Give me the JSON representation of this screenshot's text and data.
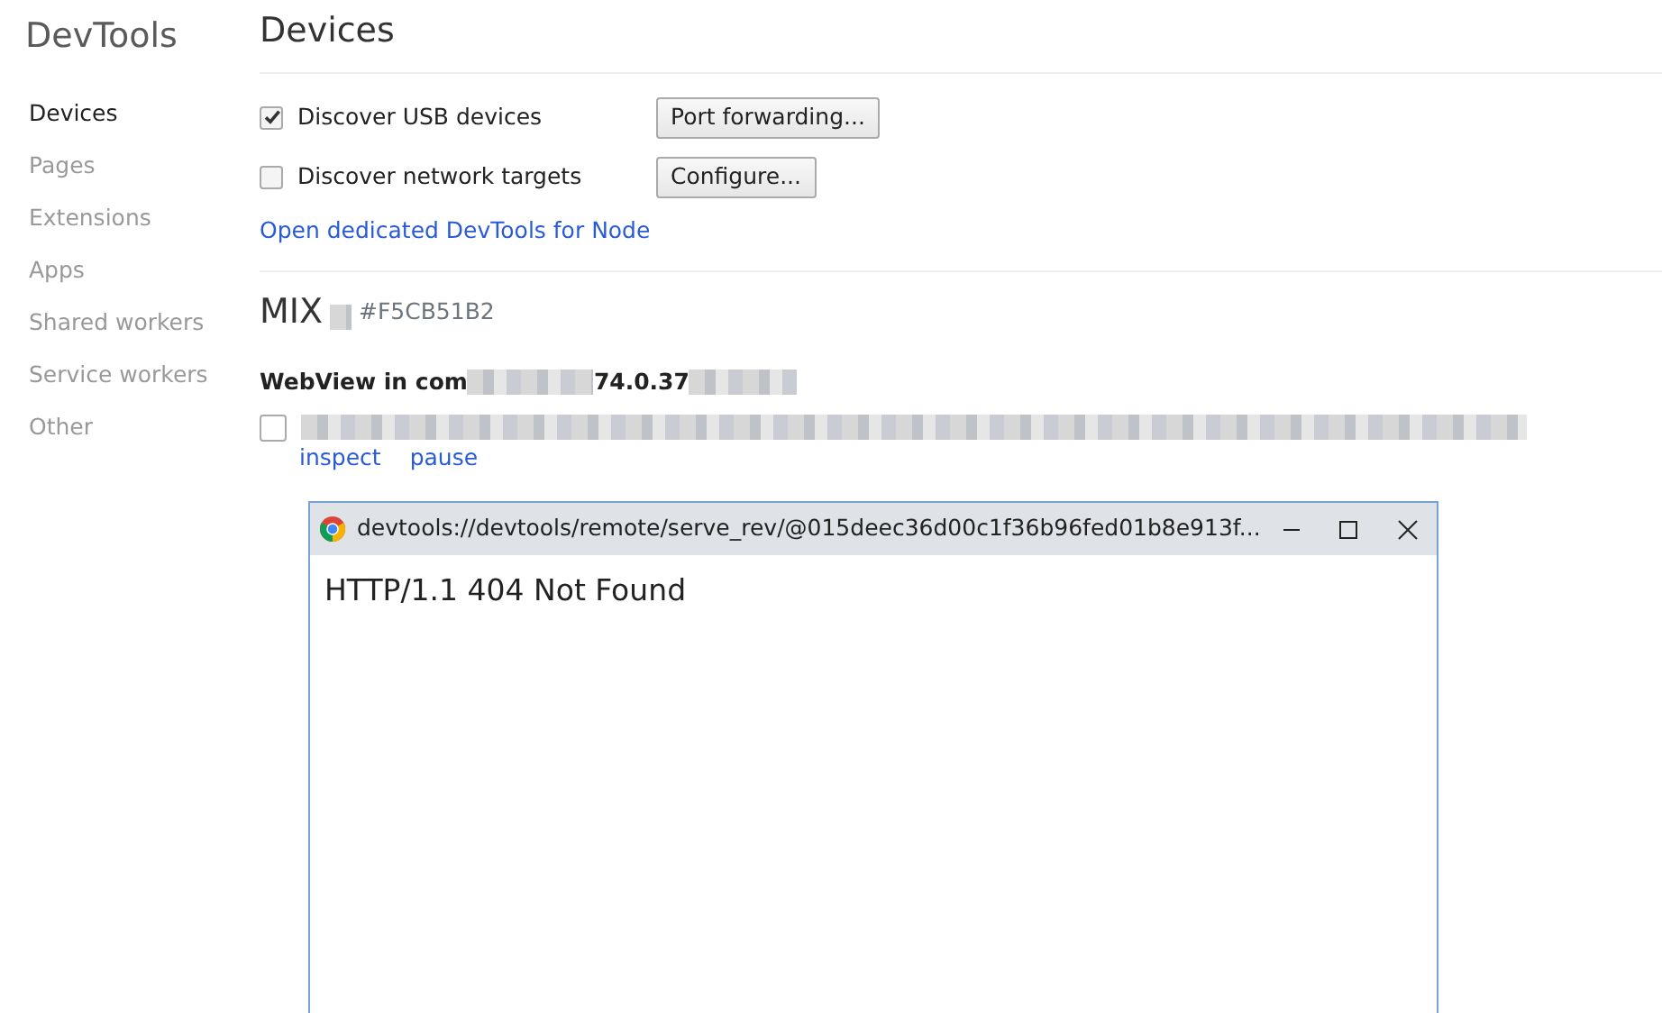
{
  "sidebar": {
    "title": "DevTools",
    "items": [
      {
        "label": "Devices",
        "selected": true
      },
      {
        "label": "Pages",
        "selected": false
      },
      {
        "label": "Extensions",
        "selected": false
      },
      {
        "label": "Apps",
        "selected": false
      },
      {
        "label": "Shared workers",
        "selected": false
      },
      {
        "label": "Service workers",
        "selected": false
      },
      {
        "label": "Other",
        "selected": false
      }
    ]
  },
  "page": {
    "title": "Devices",
    "options": [
      {
        "label": "Discover USB devices",
        "checked": true,
        "button": "Port forwarding..."
      },
      {
        "label": "Discover network targets",
        "checked": false,
        "button": "Configure..."
      }
    ],
    "node_link": "Open dedicated DevTools for Node"
  },
  "device": {
    "name": "MIX",
    "serial": "#F5CB51B2",
    "browser_prefix": "WebView in com",
    "browser_version": "74.0.37",
    "targets": [
      {
        "checked": false,
        "actions": [
          "inspect",
          "pause"
        ]
      }
    ]
  },
  "popup": {
    "title": "devtools://devtools/remote/serve_rev/@015deec36d00c1f36b96fed01b8e913f...",
    "body": "HTTP/1.1 404 Not Found"
  }
}
